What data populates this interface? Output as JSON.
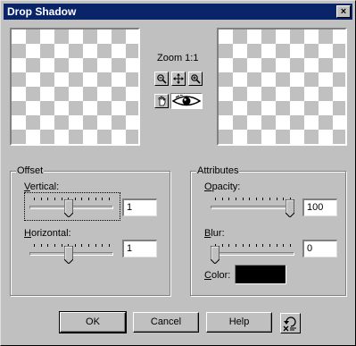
{
  "window": {
    "title": "Drop Shadow",
    "close_glyph": "×"
  },
  "preview": {
    "zoom_label": "Zoom 1:1"
  },
  "toolbar_icons": [
    "zoom-out-icon",
    "pan-icon",
    "zoom-in-icon",
    "hand-icon",
    "eye-icon"
  ],
  "offset": {
    "group_label": "Offset",
    "vertical": {
      "label_mnemonic": "V",
      "label_rest": "ertical:",
      "value": "1",
      "slider_fraction": 0.47
    },
    "horizontal": {
      "label_mnemonic": "H",
      "label_rest": "orizontal:",
      "value": "1",
      "slider_fraction": 0.47
    }
  },
  "attributes": {
    "group_label": "Attributes",
    "opacity": {
      "label_mnemonic": "O",
      "label_rest": "pacity:",
      "value": "100",
      "slider_fraction": 1.0
    },
    "blur": {
      "label_mnemonic": "B",
      "label_rest": "lur:",
      "value": "0",
      "slider_fraction": 0.0
    },
    "color": {
      "label_mnemonic": "C",
      "label_rest": "olor:",
      "value_hex": "#000000"
    }
  },
  "buttons": {
    "ok": "OK",
    "cancel": "Cancel",
    "help": "Help"
  }
}
